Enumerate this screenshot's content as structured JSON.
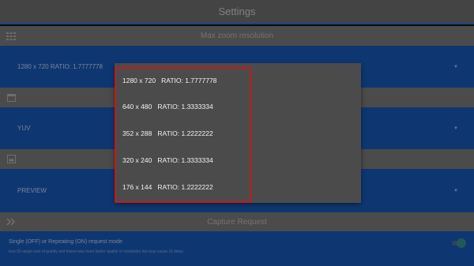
{
  "header": {
    "title": "Settings"
  },
  "sections": {
    "zoom": {
      "title": "Max zoom resolution",
      "value": "1280 x 720   RATIO: 1.7777778",
      "icon": "grid-icon"
    },
    "format": {
      "value": "YUV",
      "icon": "calendar-icon"
    },
    "template": {
      "value": "PREVIEW",
      "icon": "frame-icon"
    },
    "capture": {
      "title": "Capture Request",
      "icon": "double-chevron-right-icon"
    }
  },
  "toggle_row": {
    "label": "Single (OFF) or Repeating (ON) request mode",
    "hint": "less ID-range cost of quality and frame rate more better quality or resolution but may cause UI delay",
    "state": "on"
  },
  "dropdown": {
    "items": [
      "1280 x 720   RATIO: 1.7777778",
      "640 x 480   RATIO: 1.3333334",
      "352 x 288   RATIO: 1.2222222",
      "320 x 240   RATIO: 1.3333334",
      "176 x 144   RATIO: 1.2222222"
    ]
  },
  "colors": {
    "accent": "#1859b8",
    "highlight": "#c41a1a",
    "toggle_on": "#3b8f8a"
  }
}
